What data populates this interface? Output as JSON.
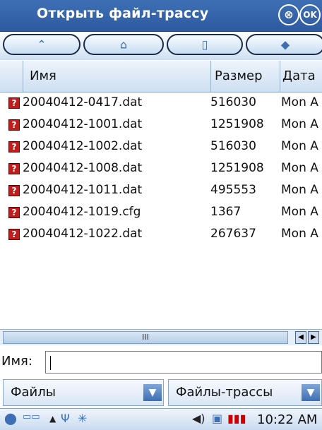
{
  "window": {
    "title": "Открыть файл-трассу",
    "close_glyph": "⊗",
    "ok_glyph": "OK"
  },
  "toolbar": {
    "icons": [
      "up-arrow-icon",
      "home-icon",
      "new-file-icon",
      "bookmark-icon"
    ],
    "glyphs": [
      "⌃",
      "⌂",
      "▯",
      "◆"
    ]
  },
  "table": {
    "columns": [
      "Имя",
      "Размер",
      "Дата"
    ],
    "rows": [
      {
        "name": "20040412-0417.dat",
        "size": "516030",
        "date": "Mon A"
      },
      {
        "name": "20040412-1001.dat",
        "size": "1251908",
        "date": "Mon A"
      },
      {
        "name": "20040412-1002.dat",
        "size": "516030",
        "date": "Mon A"
      },
      {
        "name": "20040412-1008.dat",
        "size": "1251908",
        "date": "Mon A"
      },
      {
        "name": "20040412-1011.dat",
        "size": "495553",
        "date": "Mon A"
      },
      {
        "name": "20040412-1019.cfg",
        "size": "1367",
        "date": "Mon A"
      },
      {
        "name": "20040412-1022.dat",
        "size": "267637",
        "date": "Mon A"
      }
    ],
    "file_icon_glyph": "?"
  },
  "scrollbar": {
    "thumb_grip": "III",
    "left_glyph": "◀",
    "right_glyph": "▶"
  },
  "name_field": {
    "label": "Имя:",
    "value": ""
  },
  "dropdowns": {
    "location": "Файлы",
    "filetype": "Файлы-трассы",
    "arrow_glyph": "▼"
  },
  "taskbar": {
    "time": "10:22 AM",
    "glyphs": {
      "start": "⬤",
      "keyboard": "▭▭",
      "up": "▲",
      "antenna": "Ψ",
      "sync": "✳",
      "volume": "◀)",
      "battery": "▮▮▮"
    },
    "colors": {
      "battery": "#cc0000",
      "accent": "#3e6fb4"
    }
  }
}
